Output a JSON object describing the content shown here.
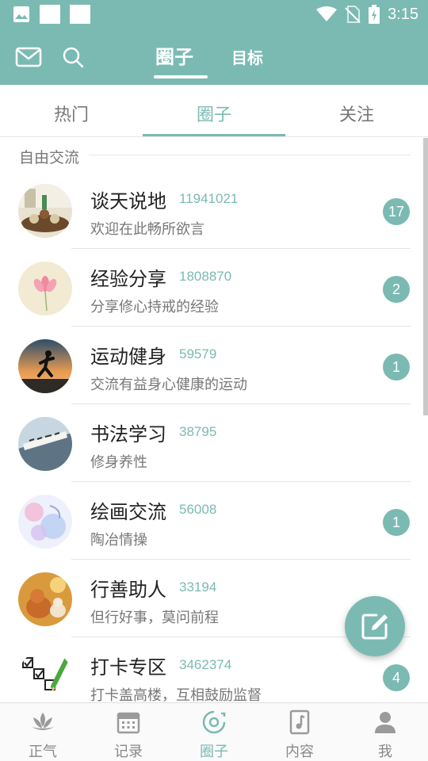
{
  "status_bar": {
    "time": "3:15"
  },
  "app_bar": {
    "icons": [
      "mail-icon",
      "search-icon"
    ],
    "tabs": [
      "圈子",
      "目标"
    ]
  },
  "sub_tabs": [
    "热门",
    "圈子",
    "关注"
  ],
  "section": {
    "title": "自由交流"
  },
  "circles": [
    {
      "name": "谈天说地",
      "count": "11941021",
      "desc": "欢迎在此畅所欲言",
      "badge": "17"
    },
    {
      "name": "经验分享",
      "count": "1808870",
      "desc": "分享修心持戒的经验",
      "badge": "2"
    },
    {
      "name": "运动健身",
      "count": "59579",
      "desc": "交流有益身心健康的运动",
      "badge": "1"
    },
    {
      "name": "书法学习",
      "count": "38795",
      "desc": "修身养性",
      "badge": ""
    },
    {
      "name": "绘画交流",
      "count": "56008",
      "desc": "陶冶情操",
      "badge": "1"
    },
    {
      "name": "行善助人",
      "count": "33194",
      "desc": "但行好事，莫问前程",
      "badge": ""
    },
    {
      "name": "打卡专区",
      "count": "3462374",
      "desc": "打卡盖高楼，互相鼓励监督",
      "badge": "4"
    }
  ],
  "bottom_nav": [
    {
      "label": "正气",
      "icon": "lotus-icon"
    },
    {
      "label": "记录",
      "icon": "calendar-icon"
    },
    {
      "label": "圈子",
      "icon": "circle-refresh-icon"
    },
    {
      "label": "内容",
      "icon": "music-doc-icon"
    },
    {
      "label": "我",
      "icon": "person-icon"
    }
  ],
  "colors": {
    "accent": "#7bbab2"
  }
}
